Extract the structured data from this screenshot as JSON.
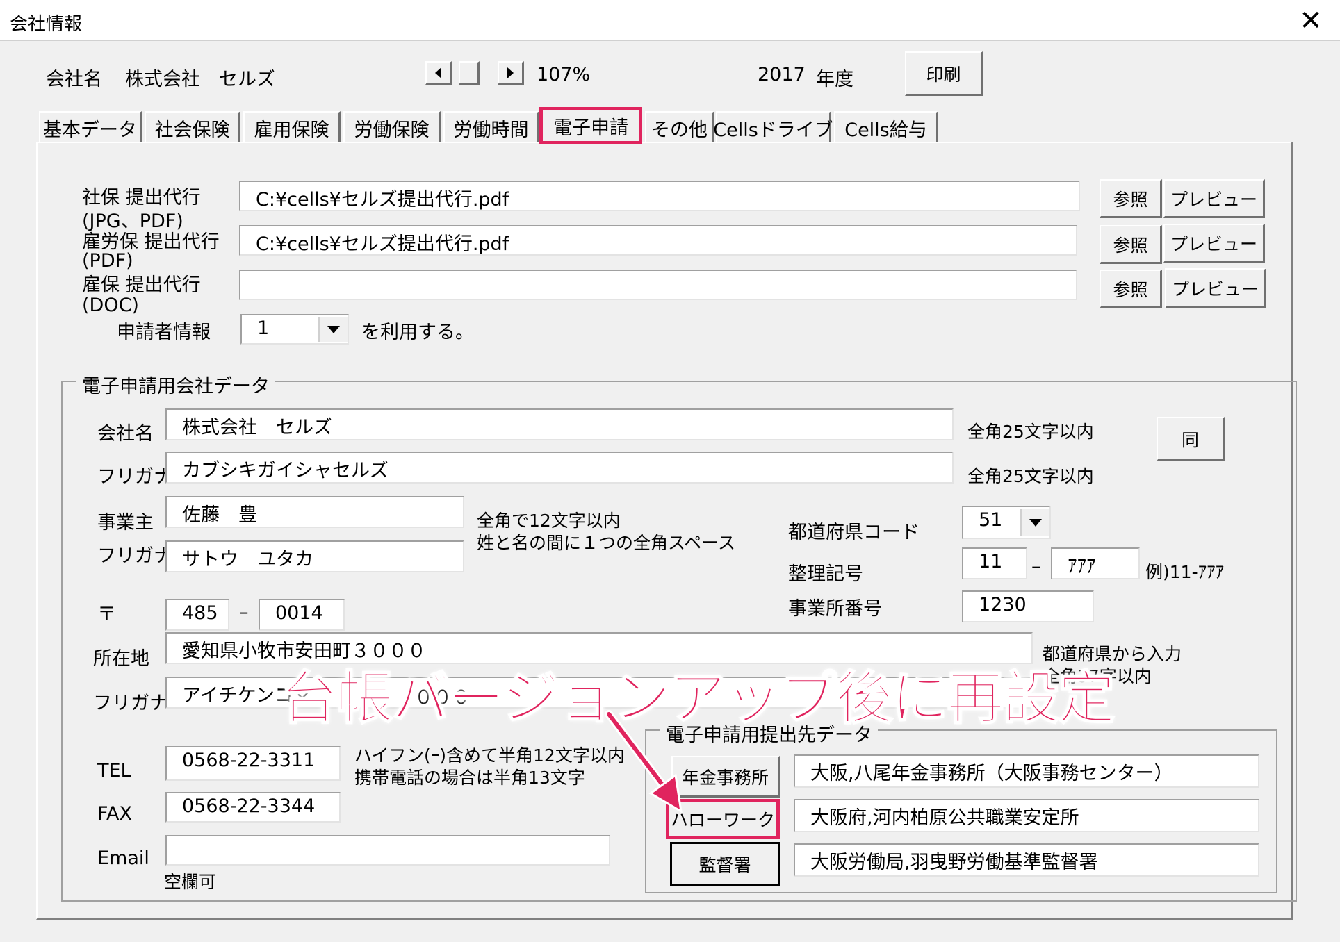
{
  "window": {
    "title": "会社情報",
    "close": "✕"
  },
  "header": {
    "company_label": "会社名",
    "company_name": "株式会社　セルズ",
    "zoom": "107%",
    "year": "2017",
    "year_unit": "年度",
    "print_button": "印刷"
  },
  "tabs": [
    {
      "label": "基本データ"
    },
    {
      "label": "社会保険"
    },
    {
      "label": "雇用保険"
    },
    {
      "label": "労働保険"
    },
    {
      "label": "労働時間"
    },
    {
      "label": "電子申請"
    },
    {
      "label": "その他"
    },
    {
      "label": "Cellsドライブ"
    },
    {
      "label": "Cells給与"
    }
  ],
  "files": [
    {
      "label1": "社保 提出代行",
      "label2": "(JPG、PDF)",
      "value": "C:¥cells¥セルズ提出代行.pdf",
      "browse": "参照",
      "preview": "プレビュー"
    },
    {
      "label1": "雇労保 提出代行",
      "label2": "(PDF)",
      "value": "C:¥cells¥セルズ提出代行.pdf",
      "browse": "参照",
      "preview": "プレビュー"
    },
    {
      "label1": "雇保 提出代行",
      "label2": "(DOC)",
      "value": "",
      "browse": "参照",
      "preview": "プレビュー"
    }
  ],
  "applicant": {
    "label": "申請者情報",
    "value": "1",
    "suffix": "を利用する。"
  },
  "company_data": {
    "group_title": "電子申請用会社データ",
    "name_label": "会社名",
    "name_value": "株式会社　セルズ",
    "name_note": "全角25文字以内",
    "same_button": "同",
    "kana_label": "フリガナ",
    "kana_value": "カブシキガイシャセルズ",
    "kana_note": "全角25文字以内",
    "owner_label": "事業主",
    "owner_value": "佐藤　豊",
    "owner_note1": "全角で12文字以内",
    "owner_note2": "姓と名の間に１つの全角スペース",
    "owner_kana_label": "フリガナ",
    "owner_kana_value": "サトウ　ユタカ",
    "pref_label": "都道府県コード",
    "pref_value": "51",
    "seiri_label": "整理記号",
    "seiri_value1": "11",
    "seiri_dash": "–",
    "seiri_value2": "ｱｱｱ",
    "seiri_example": "例)11-ｱｱｱ",
    "office_label": "事業所番号",
    "office_value": "1230",
    "zip_label": "〒",
    "zip1": "485",
    "zip_dash": "–",
    "zip2": "0014",
    "address_label": "所在地",
    "address_value": "愛知県小牧市安田町３０００",
    "address_note1": "都道府県から入力",
    "address_note2": "全角37字以内",
    "address_kana_label": "フリガナ",
    "address_kana_value": "アイチケンコマ",
    "address_kana_tail": "０００",
    "tel_label": "TEL",
    "tel_value": "0568-22-3311",
    "tel_note1": "ハイフン(ｰ)含めて半角12文字以内",
    "tel_note2": "携帯電話の場合は半角13文字",
    "fax_label": "FAX",
    "fax_value": "0568-22-3344",
    "email_label": "Email",
    "email_value": "",
    "email_note": "空欄可"
  },
  "destinations": {
    "group_title": "電子申請用提出先データ",
    "items": [
      {
        "button": "年金事務所",
        "value": "大阪,八尾年金事務所（大阪事務センター）"
      },
      {
        "button": "ハローワーク",
        "value": "大阪府,河内柏原公共職業安定所"
      },
      {
        "button": "監督署",
        "value": "大阪労働局,羽曳野労働基準監督署"
      }
    ]
  },
  "annotation": {
    "text": "台帳バージョンアップ後に再設定",
    "color": "#e0245e"
  }
}
